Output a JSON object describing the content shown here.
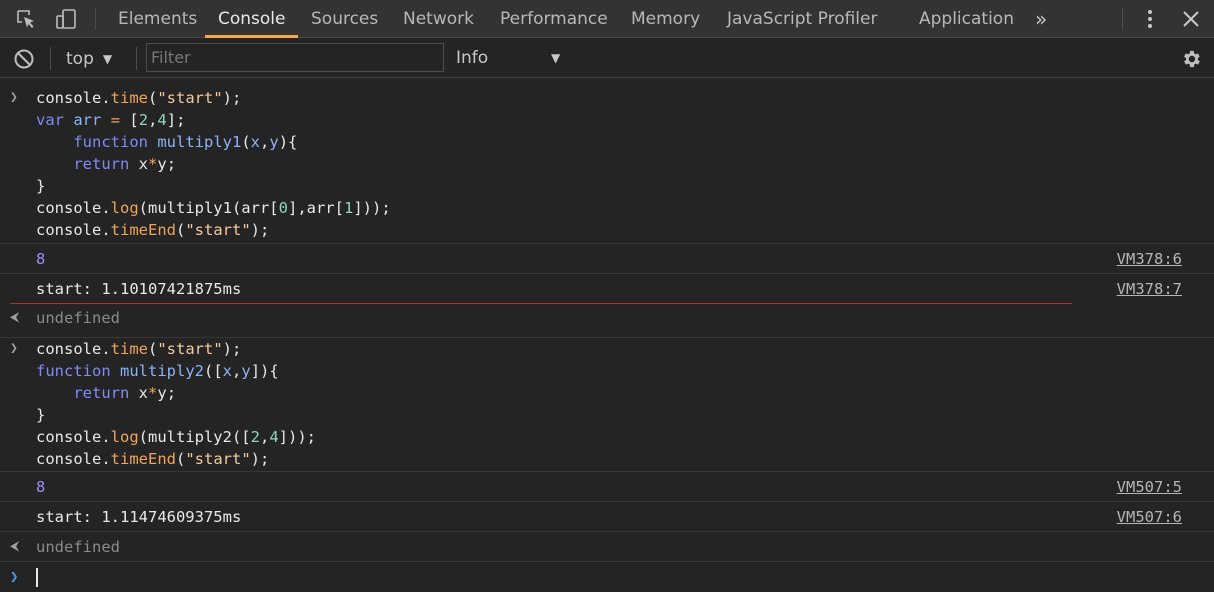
{
  "tabs": [
    {
      "label": "Elements"
    },
    {
      "label": "Console"
    },
    {
      "label": "Sources"
    },
    {
      "label": "Network"
    },
    {
      "label": "Performance"
    },
    {
      "label": "Memory"
    },
    {
      "label": "JavaScript Profiler"
    },
    {
      "label": "Application"
    }
  ],
  "active_tab": "Console",
  "more_tabs_glyph": "»",
  "toolbar": {
    "context": "top",
    "filter_placeholder": "Filter",
    "filter_value": "",
    "level": "Info"
  },
  "entries": [
    {
      "input": [
        "console.time(\"start\");",
        "var arr = [2,4];",
        "    function multiply1(x,y){",
        "    return x*y;",
        "}",
        "console.log(multiply1(arr[0],arr[1]));",
        "console.timeEnd(\"start\");"
      ],
      "outputs": [
        {
          "text": "8",
          "source": "VM378:6"
        },
        {
          "text": "start: 1.10107421875ms",
          "source": "VM378:7"
        }
      ],
      "result": "undefined"
    },
    {
      "input": [
        "console.time(\"start\");",
        "function multiply2([x,y]){",
        "    return x*y;",
        "}",
        "console.log(multiply2([2,4]));",
        "console.timeEnd(\"start\");"
      ],
      "outputs": [
        {
          "text": "8",
          "source": "VM507:5"
        },
        {
          "text": "start: 1.11474609375ms",
          "source": "VM507:6"
        }
      ],
      "result": "undefined"
    }
  ],
  "prompt_value": "",
  "colors": {
    "accent_tab": "#f8a84c",
    "number_output": "#9d8bff",
    "keyword": "#7f8cf6",
    "string": "#f6c89f",
    "method": "#f0a55a",
    "background": "#242424"
  },
  "icons": [
    "inspect-element-icon",
    "device-toolbar-icon",
    "more-tabs-icon",
    "kebab-menu-icon",
    "close-icon",
    "clear-console-icon",
    "dropdown-arrow-icon",
    "settings-gear-icon",
    "input-chevron-icon",
    "result-arrow-icon",
    "prompt-chevron-icon"
  ]
}
